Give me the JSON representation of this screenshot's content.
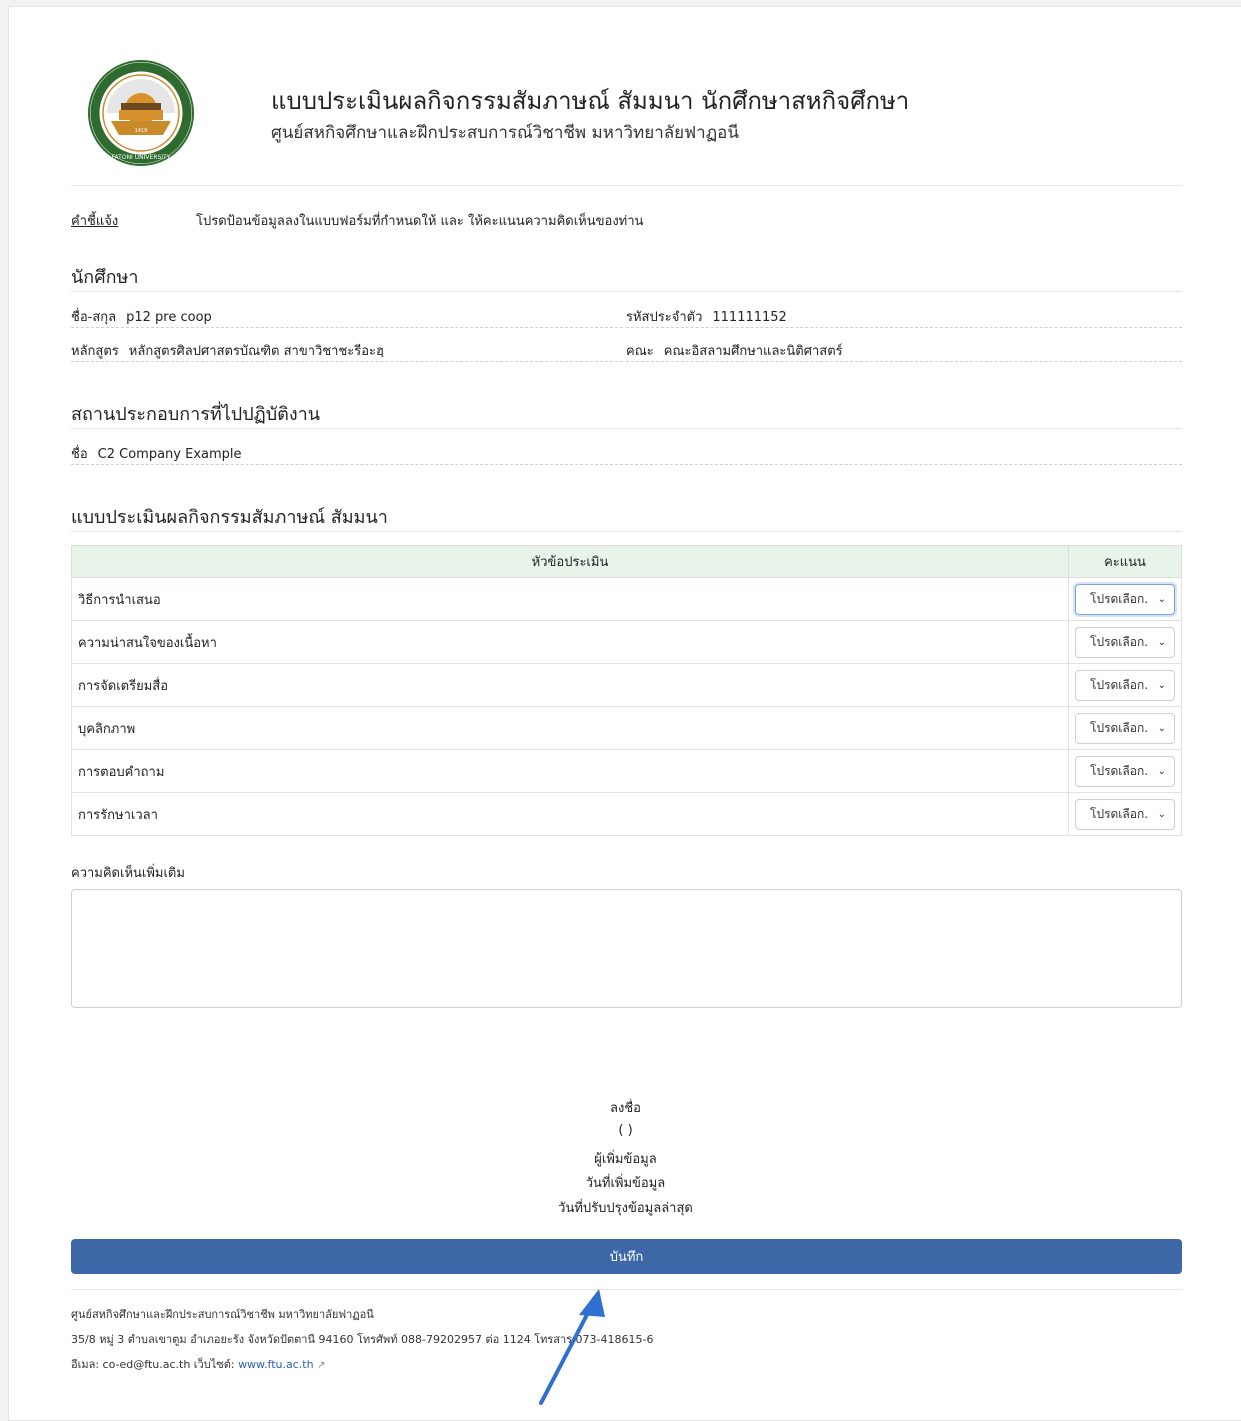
{
  "header": {
    "title": "แบบประเมินผลกิจกรรมสัมภาษณ์ สัมมนา นักศึกษาสหกิจศึกษา",
    "subtitle": "ศูนย์สหกิจศึกษาและฝึกประสบการณ์วิชาชีพ มหาวิทยาลัยฟาฏอนี",
    "logo_text": "FATONI UNIVERSITY"
  },
  "instructions": {
    "label": "คำชี้แจ้ง",
    "text": "โปรดป้อนข้อมูลลงในแบบฟอร์มที่กำหนดให้ และ ให้คะแนนความคิดเห็นของท่าน"
  },
  "student": {
    "section_title": "นักศึกษา",
    "name_label": "ชื่อ-สกุล",
    "name_value": "p12 pre coop",
    "id_label": "รหัสประจำตัว",
    "id_value": "111111152",
    "program_label": "หลักสูตร",
    "program_value": "หลักสูตรศิลปศาสตรบัณฑิต สาขาวิชาชะรีอะฮฺ",
    "faculty_label": "คณะ",
    "faculty_value": "คณะอิสลามศึกษาและนิติศาสตร์"
  },
  "workplace": {
    "section_title": "สถานประกอบการที่ไปปฏิบัติงาน",
    "name_label": "ชื่อ",
    "name_value": "C2 Company Example"
  },
  "evaluation": {
    "section_title": "แบบประเมินผลกิจกรรมสัมภาษณ์ สัมมนา",
    "col_topic": "หัวข้อประเมิน",
    "col_score": "คะแนน",
    "rows": [
      {
        "topic": "วิธีการนำเสนอ",
        "select": "โปรดเลือก."
      },
      {
        "topic": "ความน่าสนใจของเนื้อหา",
        "select": "โปรดเลือก."
      },
      {
        "topic": "การจัดเตรียมสื่อ",
        "select": "โปรดเลือก."
      },
      {
        "topic": "บุคลิกภาพ",
        "select": "โปรดเลือก."
      },
      {
        "topic": "การตอบคำถาม",
        "select": "โปรดเลือก."
      },
      {
        "topic": "การรักษาเวลา",
        "select": "โปรดเลือก."
      }
    ]
  },
  "comment": {
    "label": "ความคิดเห็นเพิ่มเติม",
    "value": ""
  },
  "signature": {
    "sign_label": "ลงชื่อ",
    "name_paren": "( )",
    "added_by": "ผู้เพิ่มข้อมูล",
    "added_date": "วันที่เพิ่มข้อมูล",
    "updated_date": "วันที่ปรับปรุงข้อมูลล่าสุด"
  },
  "save_button": "บันทึก",
  "footer": {
    "line1": "ศูนย์สหกิจศึกษาและฝึกประสบการณ์วิชาชีพ มหาวิทยาลัยฟาฏอนี",
    "line2": "35/8 หมู่ 3 ตำบลเขาตูม อำเภอยะรัง จังหวัดปัตตานี 94160 โทรศัพท์ 088-79202957 ต่อ 1124 โทรสาร 073-418615-6",
    "email_prefix": "อีเมล: co-ed@ftu.ac.th เว็บไซต์:",
    "website": "www.ftu.ac.th",
    "external_icon": "external-link-icon"
  },
  "colors": {
    "accent": "#3d67a6",
    "table_header": "#e8f4ea",
    "arrow": "#2f6fcf"
  }
}
